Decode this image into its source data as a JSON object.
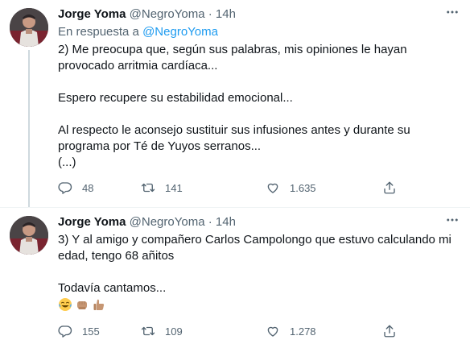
{
  "tweets": [
    {
      "author_name": "Jorge Yoma",
      "author_handle": "@NegroYoma",
      "separator": "·",
      "time": "14h",
      "reply_prefix": "En respuesta a",
      "reply_handle": "@NegroYoma",
      "paragraphs": [
        "2) Me preocupa que, según sus palabras, mis opiniones le hayan provocado arritmia cardíaca...",
        "Espero recupere su estabilidad emocional...",
        "Al respecto le aconsejo sustituir sus infusiones antes y durante su programa por Té de Yuyos serranos...",
        "(...)"
      ],
      "replies": "48",
      "retweets": "141",
      "likes": "1.635"
    },
    {
      "author_name": "Jorge Yoma",
      "author_handle": "@NegroYoma",
      "separator": "·",
      "time": "14h",
      "paragraphs": [
        "3) Y al amigo y compañero Carlos Campolongo que estuvo calculando mi edad, tengo 68 añitos",
        "Todavía cantamos..."
      ],
      "emojis": [
        "face-with-tears-of-joy",
        "fist-bump-medium-skin",
        "thumbs-up-medium-skin"
      ],
      "replies": "155",
      "retweets": "109",
      "likes": "1.278"
    }
  ],
  "icons": [
    "more-icon",
    "reply-icon",
    "retweet-icon",
    "like-icon",
    "share-icon"
  ],
  "colors": {
    "text": "#0f1419",
    "muted": "#536471",
    "link": "#1d9bf0",
    "thread_line": "#cfd9de",
    "emoji_skin": "#c69673"
  }
}
